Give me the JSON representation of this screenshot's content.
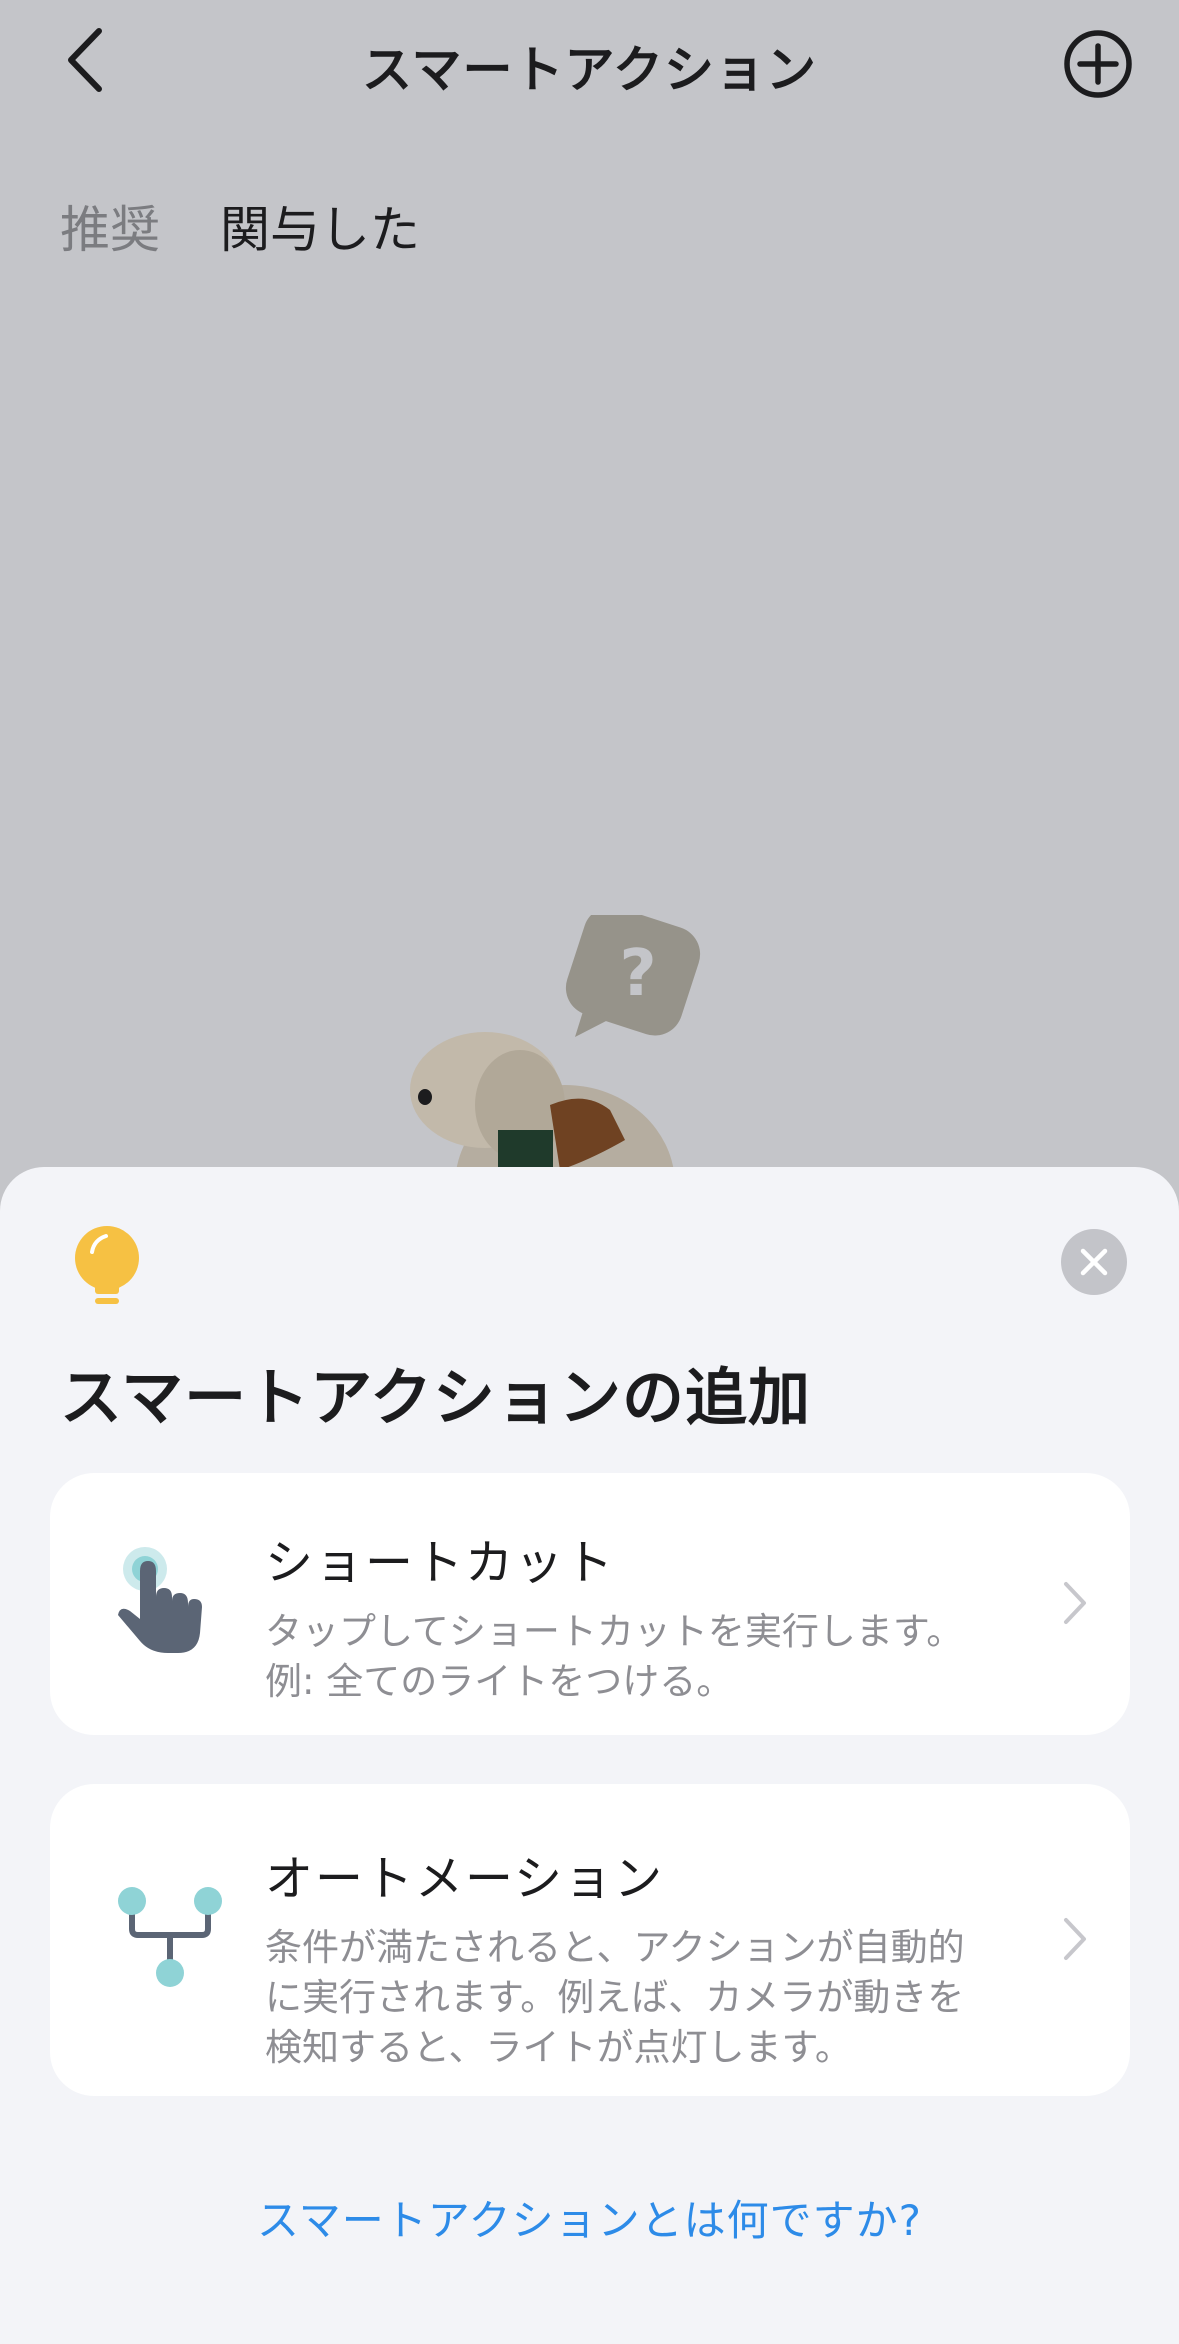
{
  "nav": {
    "title": "スマートアクション",
    "back_icon": "chevron-left-icon",
    "add_icon": "plus-circle-icon"
  },
  "tabs": [
    {
      "label": "推奨",
      "active": false
    },
    {
      "label": "関与した",
      "active": true
    }
  ],
  "empty_state": {
    "illustration": "confused-dog-mascot"
  },
  "sheet": {
    "title": "スマートアクションの追加",
    "options": [
      {
        "title": "ショートカット",
        "description": "タップしてショートカットを実行します。例: 全てのライトをつける。",
        "icon": "tap-hand-icon"
      },
      {
        "title": "オートメーション",
        "description": "条件が満たされると、アクションが自動的に実行されます。例えば、カメラが動きを検知すると、ライトが点灯します。",
        "icon": "branch-flow-icon"
      }
    ],
    "help_link": "スマートアクションとは何ですか?"
  },
  "colors": {
    "overlay_bg": "#c4c5c9",
    "sheet_bg": "#f3f4f8",
    "card_bg": "#ffffff",
    "link": "#2d8be8",
    "bulb": "#f6c143"
  }
}
